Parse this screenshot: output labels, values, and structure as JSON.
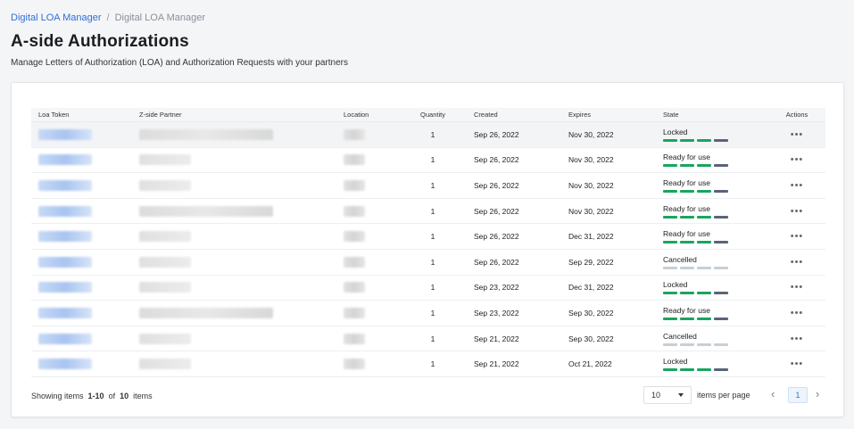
{
  "breadcrumb": {
    "parent": "Digital LOA Manager",
    "separator": "/",
    "current": "Digital LOA Manager"
  },
  "page": {
    "title": "A-side Authorizations",
    "subtitle": "Manage Letters of Authorization (LOA) and Authorization Requests with your partners"
  },
  "table": {
    "headers": {
      "token": "Loa Token",
      "partner": "Z-side Partner",
      "location": "Location",
      "quantity": "Quantity",
      "created": "Created",
      "expires": "Expires",
      "state": "State",
      "actions": "Actions"
    },
    "rows": [
      {
        "quantity": "1",
        "created": "Sep 26, 2022",
        "expires": "Nov 30, 2022",
        "state": "Locked",
        "partner_len": "long"
      },
      {
        "quantity": "1",
        "created": "Sep 26, 2022",
        "expires": "Nov 30, 2022",
        "state": "Ready for use",
        "partner_len": "short"
      },
      {
        "quantity": "1",
        "created": "Sep 26, 2022",
        "expires": "Nov 30, 2022",
        "state": "Ready for use",
        "partner_len": "short"
      },
      {
        "quantity": "1",
        "created": "Sep 26, 2022",
        "expires": "Nov 30, 2022",
        "state": "Ready for use",
        "partner_len": "long"
      },
      {
        "quantity": "1",
        "created": "Sep 26, 2022",
        "expires": "Dec 31, 2022",
        "state": "Ready for use",
        "partner_len": "short"
      },
      {
        "quantity": "1",
        "created": "Sep 26, 2022",
        "expires": "Sep 29, 2022",
        "state": "Cancelled",
        "partner_len": "short"
      },
      {
        "quantity": "1",
        "created": "Sep 23, 2022",
        "expires": "Dec 31, 2022",
        "state": "Locked",
        "partner_len": "short"
      },
      {
        "quantity": "1",
        "created": "Sep 23, 2022",
        "expires": "Sep 30, 2022",
        "state": "Ready for use",
        "partner_len": "long"
      },
      {
        "quantity": "1",
        "created": "Sep 21, 2022",
        "expires": "Sep 30, 2022",
        "state": "Cancelled",
        "partner_len": "short"
      },
      {
        "quantity": "1",
        "created": "Sep 21, 2022",
        "expires": "Oct 21, 2022",
        "state": "Locked",
        "partner_len": "short"
      }
    ],
    "actions_glyph": "•••"
  },
  "state_colors": {
    "Locked": [
      "#1aa55f",
      "#1aa55f",
      "#1aa55f",
      "#5a6478"
    ],
    "Ready for use": [
      "#1aa55f",
      "#1aa55f",
      "#1aa55f",
      "#5a6478"
    ],
    "Cancelled": [
      "#c9ced6",
      "#c9ced6",
      "#c9ced6",
      "#c9ced6"
    ]
  },
  "footer": {
    "showing_prefix": "Showing items",
    "range": "1-10",
    "of_label": "of",
    "total": "10",
    "items_label": "items",
    "per_page_value": "10",
    "per_page_label": "items per page",
    "current_page": "1",
    "prev_glyph": "‹",
    "next_glyph": "›"
  }
}
